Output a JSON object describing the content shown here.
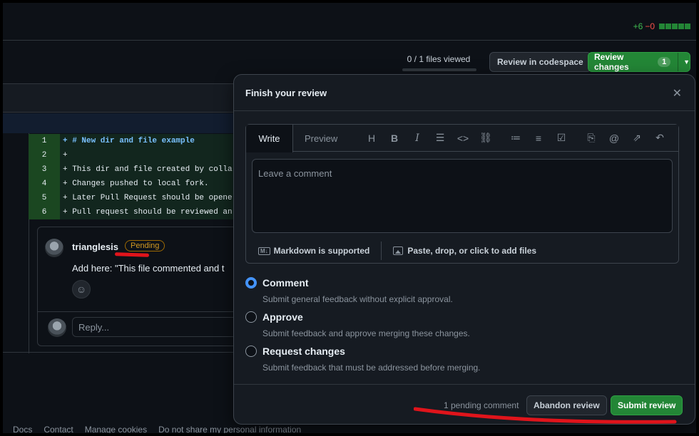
{
  "diffstat": {
    "added": "+6",
    "removed": "−0"
  },
  "toolbar": {
    "files_viewed": "0 / 1 files viewed",
    "codespace_label": "Review in codespace",
    "review_changes_label": "Review changes",
    "review_changes_count": "1"
  },
  "diff": {
    "lines": [
      {
        "num": "1",
        "code": "+ # New dir and file example"
      },
      {
        "num": "2",
        "code": "+"
      },
      {
        "num": "3",
        "code": "+ This dir and file created by colla"
      },
      {
        "num": "4",
        "code": "+ Changes pushed to local fork."
      },
      {
        "num": "5",
        "code": "+ Later Pull Request should be opene"
      },
      {
        "num": "6",
        "code": "+ Pull request should be reviewed an"
      }
    ]
  },
  "thread": {
    "author": "trianglesis",
    "status_badge": "Pending",
    "comment": "Add here: \"This file commented and t",
    "reply_placeholder": "Reply..."
  },
  "popover": {
    "title": "Finish your review",
    "tab_write": "Write",
    "tab_preview": "Preview",
    "comment_placeholder": "Leave a comment",
    "markdown_note": "Markdown is supported",
    "attach_note": "Paste, drop, or click to add files",
    "options": [
      {
        "label": "Comment",
        "desc": "Submit general feedback without explicit approval.",
        "checked": true
      },
      {
        "label": "Approve",
        "desc": "Submit feedback and approve merging these changes.",
        "checked": false
      },
      {
        "label": "Request changes",
        "desc": "Submit feedback that must be addressed before merging.",
        "checked": false
      }
    ],
    "pending_count": "1 pending comment",
    "abandon_label": "Abandon review",
    "submit_label": "Submit review"
  },
  "footer": {
    "links": [
      "Docs",
      "Contact",
      "Manage cookies",
      "Do not share my personal information"
    ]
  },
  "colors": {
    "accent_green": "#238636",
    "accent_blue": "#4493f8",
    "pending_badge": "#d29922",
    "annotation_red": "#e0141b"
  }
}
